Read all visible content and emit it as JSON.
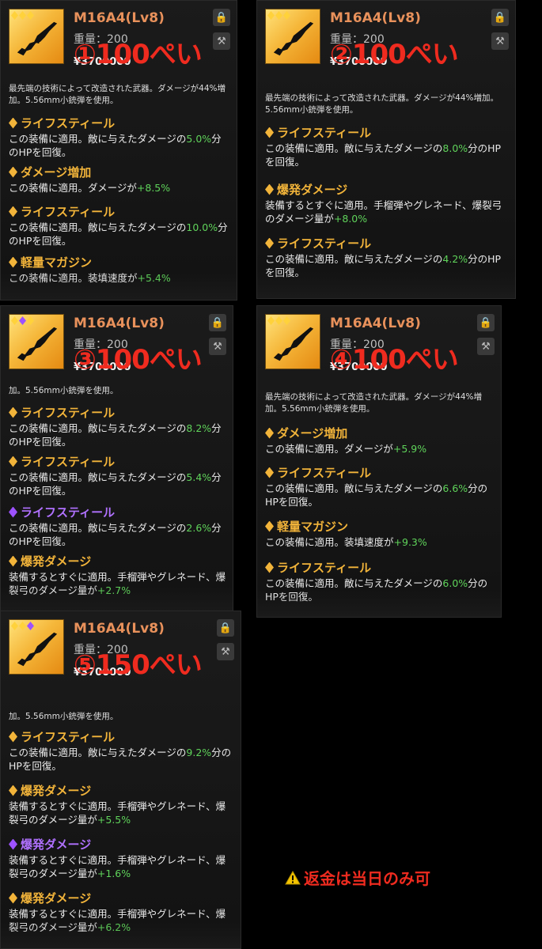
{
  "cards": [
    {
      "id": "p1",
      "rarity": [
        "gold",
        "gold",
        "gold"
      ],
      "title": "M16A4(Lv8)",
      "weight": "重量：200",
      "price": "¥3700000",
      "overlay": "①100ぺい",
      "desc": "最先端の技術によって改造された武器。ダメージが44%増加。5.56mm小銃弾を使用。",
      "perks": [
        {
          "tier": "gold",
          "name": "ライフスティール",
          "text_before": "この装備に適用。敵に与えたダメージの",
          "value": "5.0%",
          "text_after": "分のHPを回復。"
        },
        {
          "tier": "gold",
          "name": "ダメージ増加",
          "text_before": "この装備に適用。ダメージが",
          "value": "+8.5%",
          "text_after": ""
        },
        {
          "tier": "gold",
          "name": "ライフスティール",
          "text_before": "この装備に適用。敵に与えたダメージの",
          "value": "10.0%",
          "text_after": "分のHPを回復。"
        },
        {
          "tier": "gold",
          "name": "軽量マガジン",
          "text_before": "この装備に適用。装填速度が",
          "value": "+5.4%",
          "text_after": ""
        }
      ]
    },
    {
      "id": "p2",
      "rarity": [
        "gold",
        "gold",
        "gold"
      ],
      "title": "M16A4(Lv8)",
      "weight": "重量：200",
      "price": "¥3700000",
      "overlay": "②100ぺい",
      "desc": "最先端の技術によって改造された武器。ダメージが44%増加。5.56mm小銃弾を使用。",
      "perks": [
        {
          "tier": "gold",
          "name": "ライフスティール",
          "text_before": "この装備に適用。敵に与えたダメージの",
          "value": "8.0%",
          "text_after": "分のHPを回復。"
        },
        {
          "tier": "gold",
          "name": "爆発ダメージ",
          "text_before": "装備するとすぐに適用。手榴弾やグレネード、爆裂弓のダメージ量が",
          "value": "+8.0%",
          "text_after": ""
        },
        {
          "tier": "gold",
          "name": "ライフスティール",
          "text_before": "この装備に適用。敵に与えたダメージの",
          "value": "4.2%",
          "text_after": "分のHPを回復。"
        }
      ]
    },
    {
      "id": "p3",
      "rarity": [
        "gold",
        "purple",
        "gold"
      ],
      "title": "M16A4(Lv8)",
      "weight": "重量：200",
      "price": "¥3700000",
      "overlay": "③100ぺい",
      "desc": "加。5.56mm小銃弾を使用。",
      "perks": [
        {
          "tier": "gold",
          "name": "ライフスティール",
          "text_before": "この装備に適用。敵に与えたダメージの",
          "value": "8.2%",
          "text_after": "分のHPを回復。"
        },
        {
          "tier": "gold",
          "name": "ライフスティール",
          "text_before": "この装備に適用。敵に与えたダメージの",
          "value": "5.4%",
          "text_after": "分のHPを回復。"
        },
        {
          "tier": "purple",
          "name": "ライフスティール",
          "text_before": "この装備に適用。敵に与えたダメージの",
          "value": "2.6%",
          "text_after": "分のHPを回復。"
        },
        {
          "tier": "gold",
          "name": "爆発ダメージ",
          "text_before": "装備するとすぐに適用。手榴弾やグレネード、爆裂弓のダメージ量が",
          "value": "+2.7%",
          "text_after": ""
        }
      ]
    },
    {
      "id": "p4",
      "rarity": [
        "gold",
        "gold",
        "gold"
      ],
      "title": "M16A4(Lv8)",
      "weight": "重量：200",
      "price": "¥3700000",
      "overlay": "④100ぺい",
      "desc": "最先端の技術によって改造された武器。ダメージが44%増加。5.56mm小銃弾を使用。",
      "perks": [
        {
          "tier": "gold",
          "name": "ダメージ増加",
          "text_before": "この装備に適用。ダメージが",
          "value": "+5.9%",
          "text_after": ""
        },
        {
          "tier": "gold",
          "name": "ライフスティール",
          "text_before": "この装備に適用。敵に与えたダメージの",
          "value": "6.6%",
          "text_after": "分のHPを回復。"
        },
        {
          "tier": "gold",
          "name": "軽量マガジン",
          "text_before": "この装備に適用。装填速度が",
          "value": "+9.3%",
          "text_after": ""
        },
        {
          "tier": "gold",
          "name": "ライフスティール",
          "text_before": "この装備に適用。敵に与えたダメージの",
          "value": "6.0%",
          "text_after": "分のHPを回復。"
        }
      ]
    },
    {
      "id": "p5",
      "rarity": [
        "gold",
        "gold",
        "purple"
      ],
      "title": "M16A4(Lv8)",
      "weight": "重量：200",
      "price": "¥3700000",
      "overlay": "⑤150ぺい",
      "desc": "加。5.56mm小銃弾を使用。",
      "perks": [
        {
          "tier": "gold",
          "name": "ライフスティール",
          "text_before": "この装備に適用。敵に与えたダメージの",
          "value": "9.2%",
          "text_after": "分のHPを回復。"
        },
        {
          "tier": "gold",
          "name": "爆発ダメージ",
          "text_before": "装備するとすぐに適用。手榴弾やグレネード、爆裂弓のダメージ量が",
          "value": "+5.5%",
          "text_after": ""
        },
        {
          "tier": "purple",
          "name": "爆発ダメージ",
          "text_before": "装備するとすぐに適用。手榴弾やグレネード、爆裂弓のダメージ量が",
          "value": "+1.6%",
          "text_after": ""
        },
        {
          "tier": "gold",
          "name": "爆発ダメージ",
          "text_before": "装備するとすぐに適用。手榴弾やグレネード、爆裂弓のダメージ量が",
          "value": "+6.2%",
          "text_after": ""
        }
      ]
    }
  ],
  "notice": {
    "text": "返金は当日のみ可",
    "icon": "warning-icon"
  },
  "icons": {
    "lock": "lock-icon",
    "dismantle": "dismantle-icon",
    "gun": "rifle-icon"
  },
  "colors": {
    "title": "#e8915b",
    "gold": "#f2b43a",
    "purple": "#b071ff",
    "green": "#5fd35a",
    "overlay": "#ef2b1f"
  }
}
